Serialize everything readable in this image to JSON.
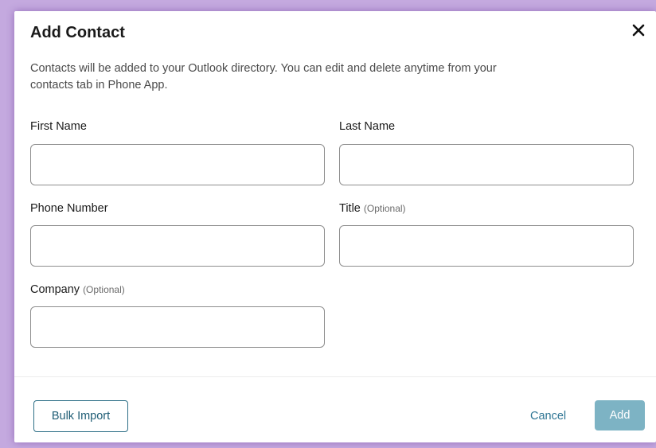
{
  "dialog": {
    "title": "Add Contact",
    "description": "Contacts will be added to your Outlook directory. You can edit and delete anytime from your contacts tab in Phone App.",
    "close_icon": "close-icon"
  },
  "fields": {
    "first_name": {
      "label": "First Name",
      "value": ""
    },
    "last_name": {
      "label": "Last Name",
      "value": ""
    },
    "phone_number": {
      "label": "Phone Number",
      "value": ""
    },
    "title": {
      "label": "Title",
      "optional": "(Optional)",
      "value": ""
    },
    "company": {
      "label": "Company",
      "optional": "(Optional)",
      "value": ""
    }
  },
  "footer": {
    "bulk_import": "Bulk Import",
    "cancel": "Cancel",
    "add": "Add"
  },
  "colors": {
    "backdrop": "#c4a9df",
    "primary_outline": "#2e6f87",
    "add_disabled": "#7db3c4"
  }
}
